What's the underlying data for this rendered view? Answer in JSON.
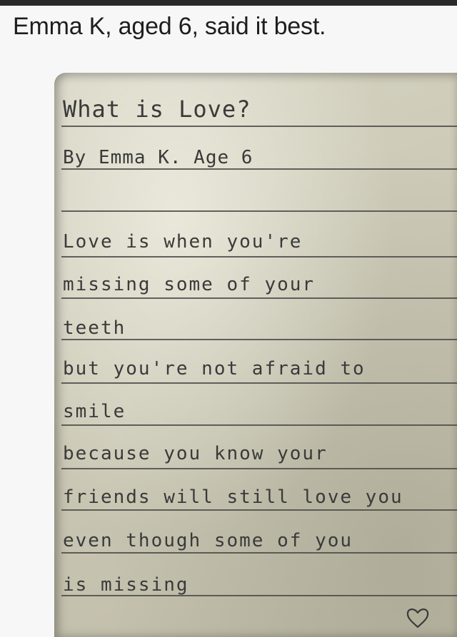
{
  "caption": "Emma K, aged 6, said it best.",
  "note": {
    "title": "What is Love?",
    "byline": "By Emma K. Age 6",
    "lines": [
      "Love is when you're",
      "missing some of your",
      "teeth",
      "but you're not afraid to",
      "smile",
      "because you know your",
      "friends will still love you",
      "even though some of you",
      "is missing"
    ],
    "ink_color": "#3a3a3a",
    "paper_color": "#cbc8b5",
    "heart_icon": "heart-outline-icon"
  }
}
